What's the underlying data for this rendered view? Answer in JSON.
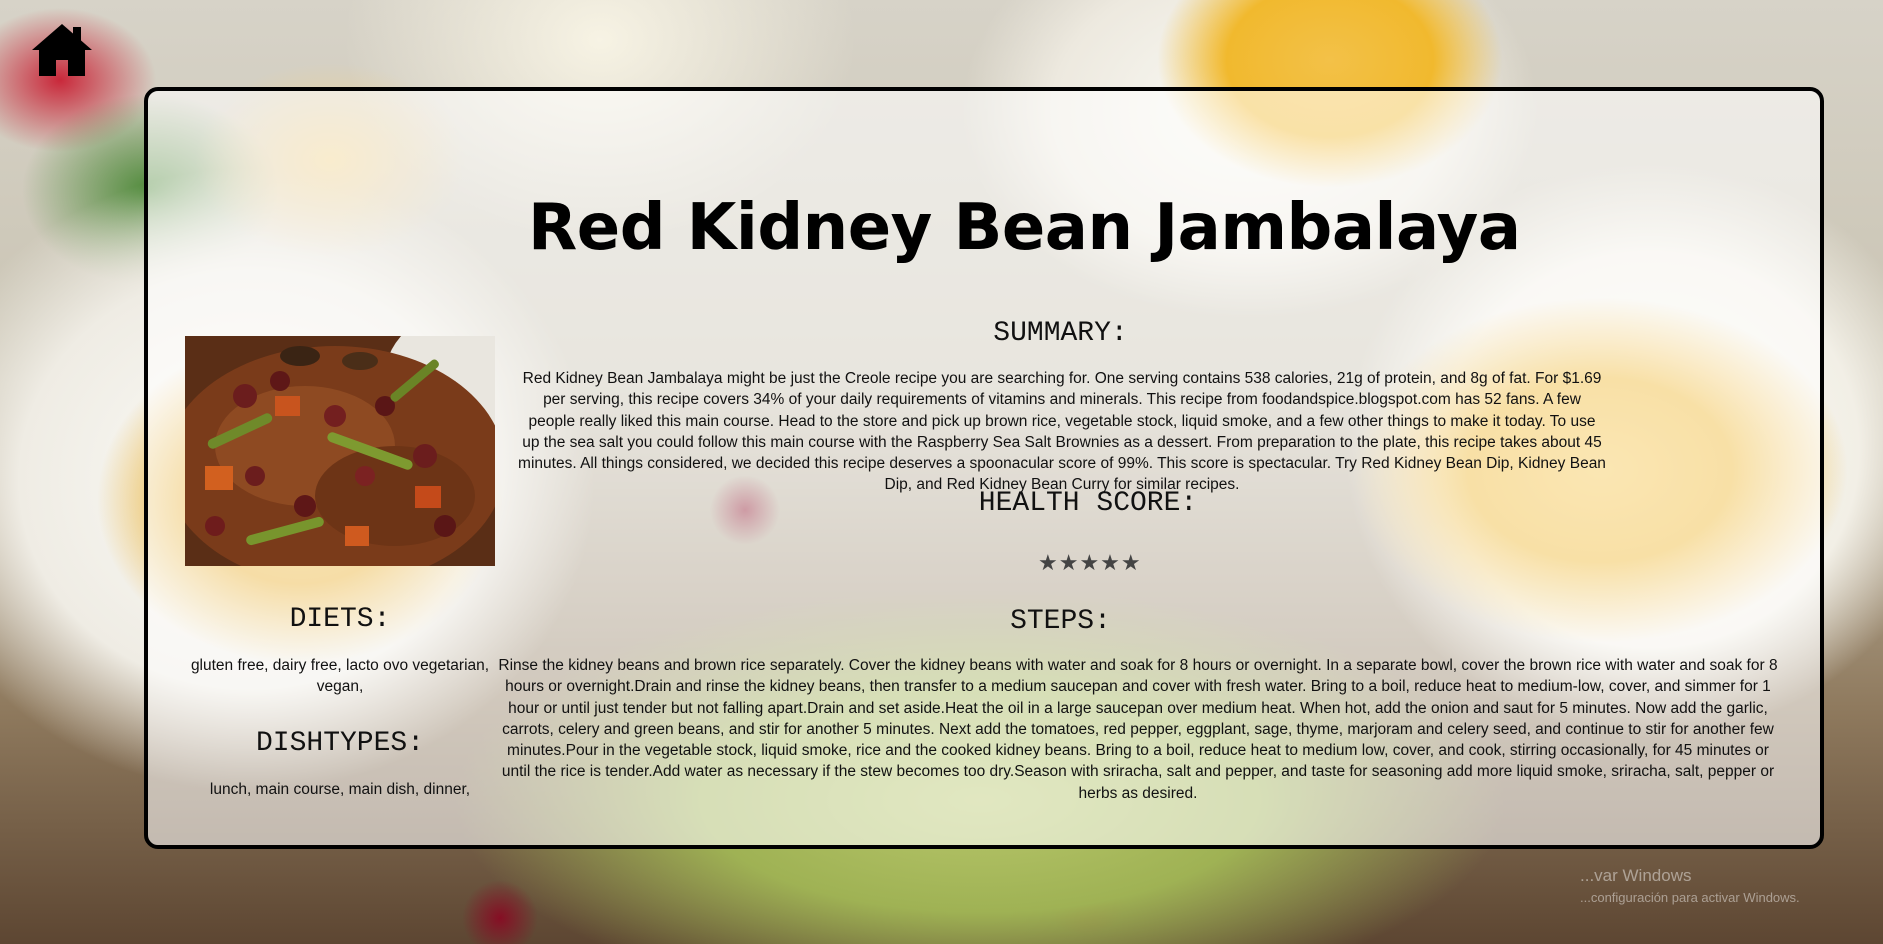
{
  "home": {
    "icon": "home-icon"
  },
  "recipe": {
    "title": "Red Kidney Bean Jambalaya",
    "image_alt": "Red Kidney Bean Jambalaya",
    "summary_heading": "SUMMARY:",
    "summary_text": "Red Kidney Bean Jambalaya might be just the Creole recipe you are searching for. One serving contains 538 calories, 21g of protein, and 8g of fat. For $1.69 per serving, this recipe covers 34% of your daily requirements of vitamins and minerals. This recipe from foodandspice.blogspot.com has 52 fans. A few people really liked this main course. Head to the store and pick up brown rice, vegetable stock, liquid smoke, and a few other things to make it today. To use up the sea salt you could follow this main course with the Raspberry Sea Salt Brownies as a dessert. From preparation to the plate, this recipe takes about 45 minutes. All things considered, we decided this recipe deserves a spoonacular score of 99%. This score is spectacular. Try Red Kidney Bean Dip, Kidney Bean Dip, and Red Kidney Bean Curry for similar recipes.",
    "health_heading": "HEALTH SCORE:",
    "health_stars": "★★★★★",
    "health_rating": 5,
    "steps_heading": "STEPS:",
    "steps_text": "Rinse the kidney beans and brown rice separately. Cover the kidney beans with water and soak for 8 hours or overnight. In a separate bowl, cover the brown rice with water and soak for 8 hours or overnight.Drain and rinse the kidney beans, then transfer to a medium saucepan and cover with fresh water. Bring to a boil, reduce heat to medium-low, cover, and simmer for 1 hour or until just tender but not falling apart.Drain and set aside.Heat the oil in a large saucepan over medium heat. When hot, add the onion and saut for 5 minutes. Now add the garlic, carrots, celery and green beans, and stir for another 5 minutes. Next add the tomatoes, red pepper, eggplant, sage, thyme, marjoram and celery seed, and continue to stir for another few minutes.Pour in the vegetable stock, liquid smoke, rice and the cooked kidney beans. Bring to a boil, reduce heat to medium low, cover, and cook, stirring occasionally, for 45 minutes or until the rice is tender.Add water as necessary if the stew becomes too dry.Season with sriracha, salt and pepper, and taste for seasoning add more liquid smoke, sriracha, salt, pepper or herbs as desired.",
    "diets_heading": "DIETS:",
    "diets_text": "gluten free, dairy free, lacto ovo vegetarian, vegan,",
    "dishtypes_heading": "DISHTYPES:",
    "dishtypes_text": "lunch, main course, main dish, dinner,"
  },
  "watermark": {
    "line1": "...var Windows",
    "line2": "...configuración para activar Windows."
  }
}
